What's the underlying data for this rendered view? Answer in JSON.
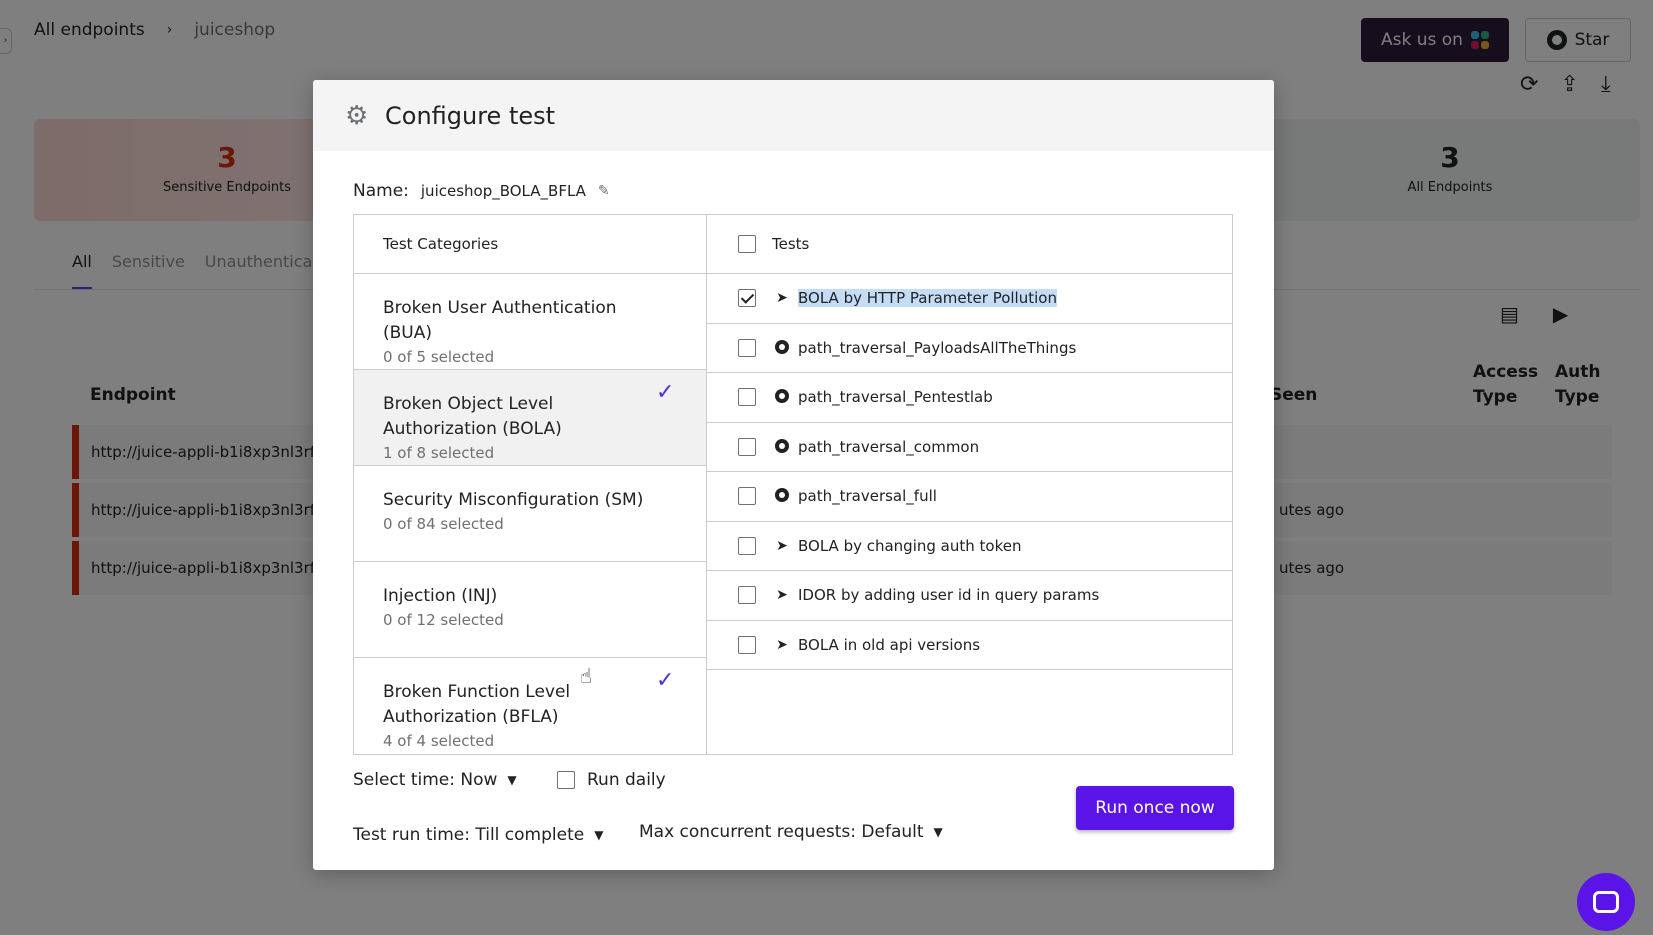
{
  "breadcrumb": {
    "root": "All endpoints",
    "separator": "›",
    "current": "juiceshop"
  },
  "header": {
    "slack_label": "Ask us on",
    "star_label": "Star"
  },
  "actions": {
    "refresh": "⟳",
    "upload": "⇪",
    "download": "⤓"
  },
  "stats": [
    {
      "value": "3",
      "label": "Sensitive Endpoints"
    },
    {
      "value": "3",
      "label": "All Endpoints"
    }
  ],
  "filter_tabs": [
    "All",
    "Sensitive",
    "Unauthenticated"
  ],
  "table": {
    "col_endpoint": "Endpoint",
    "col_seen": "Seen",
    "col_access_type": "Access Type",
    "col_auth_type": "Auth Type",
    "rows": [
      {
        "url": "http://juice-appli-b1i8xp3nl3rf-",
        "seen": ""
      },
      {
        "url": "http://juice-appli-b1i8xp3nl3rf-",
        "seen": "utes ago"
      },
      {
        "url": "http://juice-appli-b1i8xp3nl3rf-",
        "seen": "utes ago"
      }
    ]
  },
  "modal": {
    "title": "Configure test",
    "name_label": "Name:",
    "name_value": "juiceshop_BOLA_BFLA",
    "categories_header": "Test Categories",
    "tests_header": "Tests",
    "categories": [
      {
        "name": "Broken User Authentication (BUA)",
        "count": "0 of 5 selected"
      },
      {
        "name": "Broken Object Level Authorization (BOLA)",
        "count": "1 of 8 selected"
      },
      {
        "name": "Security Misconfiguration (SM)",
        "count": "0 of 84 selected"
      },
      {
        "name": "Injection (INJ)",
        "count": "0 of 12 selected"
      },
      {
        "name": "Broken Function Level Authorization (BFLA)",
        "count": "4 of 4 selected"
      }
    ],
    "tests": [
      {
        "name": "BOLA by HTTP Parameter Pollution",
        "icon": "send-icon",
        "checked": true
      },
      {
        "name": "path_traversal_PayloadsAllTheThings",
        "icon": "github-icon",
        "checked": false
      },
      {
        "name": "path_traversal_Pentestlab",
        "icon": "github-icon",
        "checked": false
      },
      {
        "name": "path_traversal_common",
        "icon": "github-icon",
        "checked": false
      },
      {
        "name": "path_traversal_full",
        "icon": "github-icon",
        "checked": false
      },
      {
        "name": "BOLA by changing auth token",
        "icon": "send-icon",
        "checked": false
      },
      {
        "name": "IDOR by adding user id in query params",
        "icon": "send-icon",
        "checked": false
      },
      {
        "name": "BOLA in old api versions",
        "icon": "send-icon",
        "checked": false
      }
    ],
    "select_time": "Select time: Now",
    "run_daily": "Run daily",
    "test_run_time": "Test run time: Till complete",
    "max_concurrent": "Max concurrent requests: Default",
    "run_button": "Run once now"
  },
  "colors": {
    "accent": "#5b14e8",
    "danger": "#d72c0d",
    "slack_bg": "#2c1a3a"
  }
}
